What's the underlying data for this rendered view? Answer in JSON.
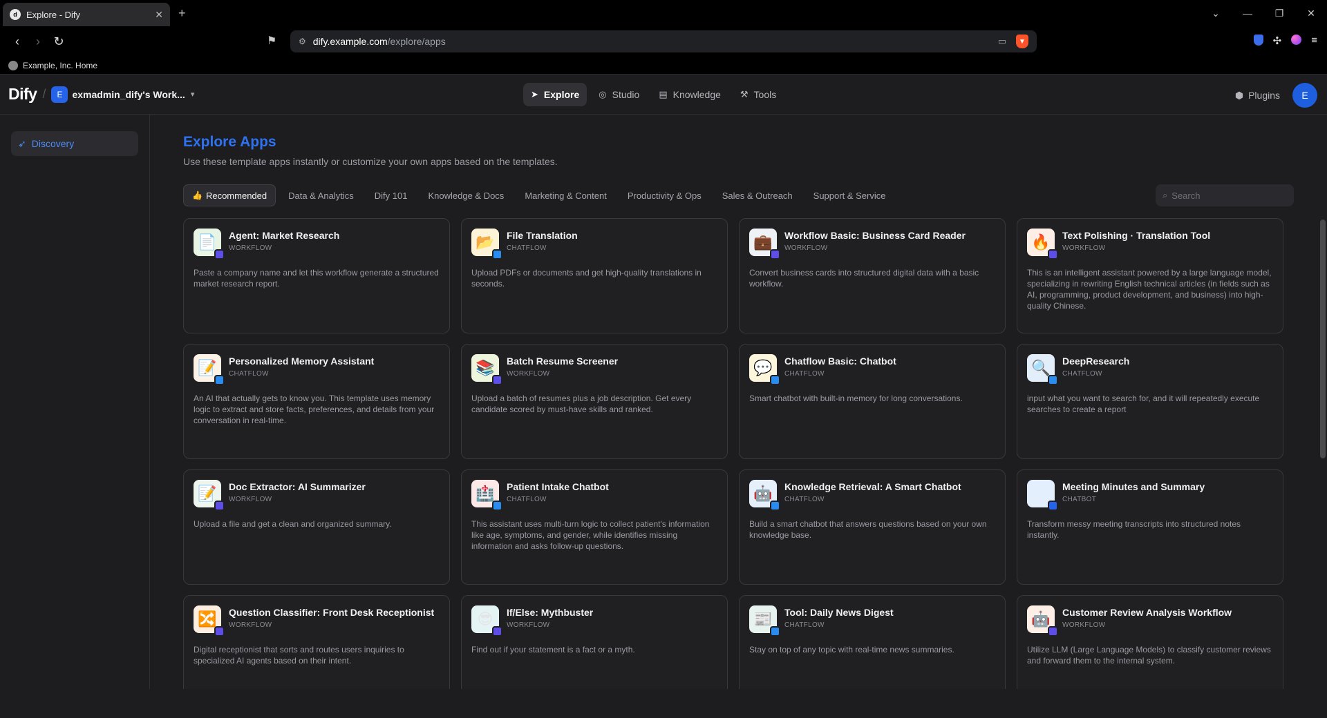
{
  "browser": {
    "tab_title": "Explore - Dify",
    "url_host": "dify.example.com",
    "url_path": "/explore/apps",
    "bookmark": "Example, Inc. Home"
  },
  "app": {
    "logo": "Dify",
    "workspace_initial": "E",
    "workspace_name": "exmadmin_dify's Work...",
    "nav": [
      "Explore",
      "Studio",
      "Knowledge",
      "Tools"
    ],
    "plugins": "Plugins",
    "avatar_initial": "E"
  },
  "sidebar": {
    "discovery": "Discovery"
  },
  "page": {
    "title": "Explore Apps",
    "subtitle": "Use these template apps instantly or customize your own apps based on the templates.",
    "categories": [
      "Recommended",
      "Data & Analytics",
      "Dify 101",
      "Knowledge & Docs",
      "Marketing & Content",
      "Productivity & Ops",
      "Sales & Outreach",
      "Support & Service"
    ],
    "search_placeholder": "Search"
  },
  "apps": [
    {
      "name": "Agent: Market Research",
      "type": "WORKFLOW",
      "desc": "Paste a company name and let this workflow generate a structured market research report.",
      "icon": "📄",
      "bg": "#e9f5e4",
      "badge": "wf"
    },
    {
      "name": "File Translation",
      "type": "CHATFLOW",
      "desc": "Upload PDFs or documents and get high-quality translations in seconds.",
      "icon": "📂",
      "bg": "#fdf4d7",
      "badge": "cf"
    },
    {
      "name": "Workflow Basic: Business Card Reader",
      "type": "WORKFLOW",
      "desc": "Convert business cards into structured digital data with a basic workflow.",
      "icon": "💼",
      "bg": "#eef2f7",
      "badge": "wf"
    },
    {
      "name": "Text Polishing · Translation Tool",
      "type": "WORKFLOW",
      "desc": "This is an intelligent assistant powered by a large language model, specializing in rewriting English technical articles (in fields such as AI, programming, product development, and business) into high-quality Chinese.",
      "icon": "🔥",
      "bg": "#fdeee6",
      "badge": "wf"
    },
    {
      "name": "Personalized Memory Assistant",
      "type": "CHATFLOW",
      "desc": "An AI that actually gets to know you. This template uses memory logic to extract and store facts, preferences, and details from your conversation in real-time.",
      "icon": "📝",
      "bg": "#fdf2e6",
      "badge": "cf"
    },
    {
      "name": "Batch Resume Screener",
      "type": "WORKFLOW",
      "desc": "Upload a batch of resumes plus a job description. Get every candidate scored by must-have skills and ranked.",
      "icon": "📚",
      "bg": "#eef5dd",
      "badge": "wf"
    },
    {
      "name": "Chatflow Basic: Chatbot",
      "type": "CHATFLOW",
      "desc": "Smart chatbot with built-in memory for long conversations.",
      "icon": "💬",
      "bg": "#fdf6dc",
      "badge": "cf"
    },
    {
      "name": "DeepResearch",
      "type": "CHATFLOW",
      "desc": "input what you want to search for, and it will repeatedly execute searches to create a report",
      "icon": "🔍",
      "bg": "#e3eefb",
      "badge": "cf"
    },
    {
      "name": "Doc Extractor: AI Summarizer",
      "type": "WORKFLOW",
      "desc": "Upload a file and get a clean and organized summary.",
      "icon": "📝",
      "bg": "#eef4ee",
      "badge": "wf"
    },
    {
      "name": "Patient Intake Chatbot",
      "type": "CHATFLOW",
      "desc": "This assistant uses multi-turn logic to collect patient's information like age, symptoms, and gender, while identifies missing information and asks follow-up questions.",
      "icon": "🏥",
      "bg": "#fde8e8",
      "badge": "cf"
    },
    {
      "name": "Knowledge Retrieval: A Smart Chatbot",
      "type": "CHATFLOW",
      "desc": "Build a smart chatbot that answers questions based on your own knowledge base.",
      "icon": "🤖",
      "bg": "#e6f0fa",
      "badge": "cf"
    },
    {
      "name": "Meeting Minutes and Summary",
      "type": "CHATBOT",
      "desc": "Transform messy meeting transcripts into structured notes instantly.",
      "icon": "",
      "bg": "#e3effc",
      "badge": "cb"
    },
    {
      "name": "Question Classifier: Front Desk Receptionist",
      "type": "WORKFLOW",
      "desc": "Digital receptionist that sorts and routes users inquiries to specialized AI agents based on their intent.",
      "icon": "🔀",
      "bg": "#fdeee2",
      "badge": "wf"
    },
    {
      "name": "If/Else: Mythbuster",
      "type": "WORKFLOW",
      "desc": "Find out if your statement is a fact or a myth.",
      "icon": "😎",
      "bg": "#e4f3f3",
      "badge": "wf"
    },
    {
      "name": "Tool: Daily News Digest",
      "type": "CHATFLOW",
      "desc": "Stay on top of any topic with real-time news summaries.",
      "icon": "📰",
      "bg": "#e6f3ef",
      "badge": "cf"
    },
    {
      "name": "Customer Review Analysis Workflow",
      "type": "WORKFLOW",
      "desc": "Utilize LLM (Large Language Models) to classify customer reviews and forward them to the internal system.",
      "icon": "🤖",
      "bg": "#fdeee6",
      "badge": "wf"
    }
  ]
}
